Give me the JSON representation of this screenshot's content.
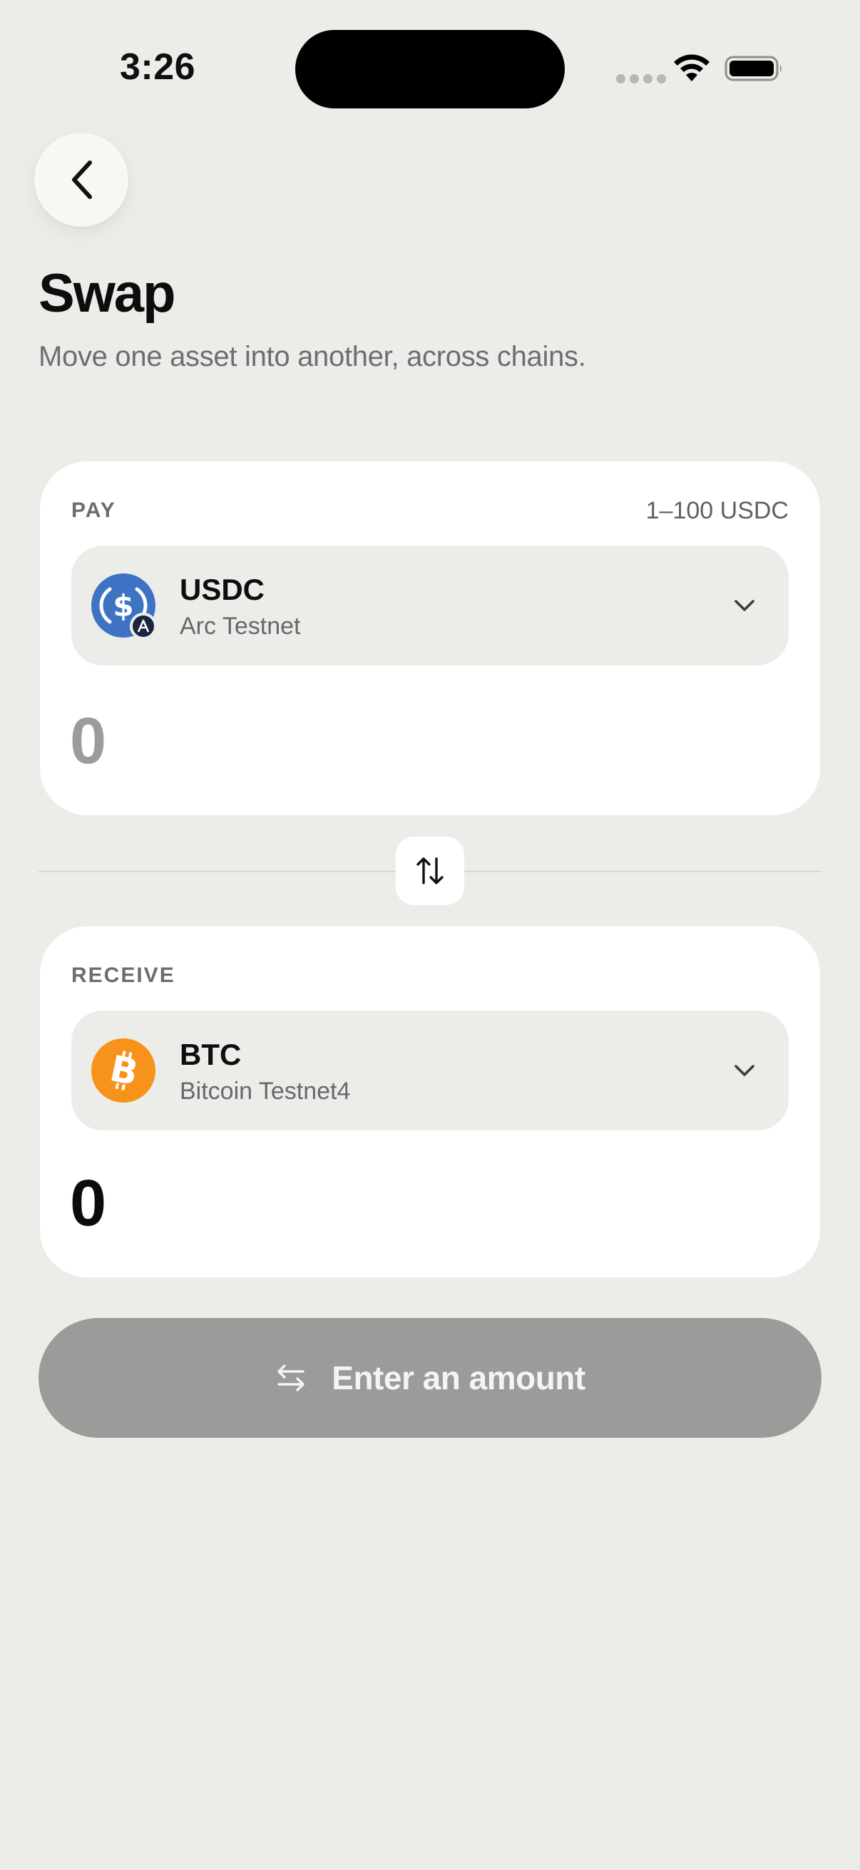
{
  "status_bar": {
    "time": "3:26"
  },
  "header": {
    "back_icon": "chevron-left-icon",
    "title": "Swap",
    "subtitle": "Move one asset into another, across chains."
  },
  "pay": {
    "label": "PAY",
    "range": "1–100 USDC",
    "token": {
      "symbol": "USDC",
      "chain": "Arc Testnet",
      "icon": "usdc-icon",
      "badge_icon": "arc-chain-icon",
      "color": "#3E73C4"
    },
    "amount_placeholder": "0"
  },
  "flip": {
    "icon": "swap-vertical-icon"
  },
  "receive": {
    "label": "RECEIVE",
    "token": {
      "symbol": "BTC",
      "chain": "Bitcoin Testnet4",
      "icon": "bitcoin-icon",
      "color": "#F7931A"
    },
    "amount": "0"
  },
  "cta": {
    "label": "Enter an amount",
    "icon": "swap-horizontal-icon",
    "disabled": true
  }
}
